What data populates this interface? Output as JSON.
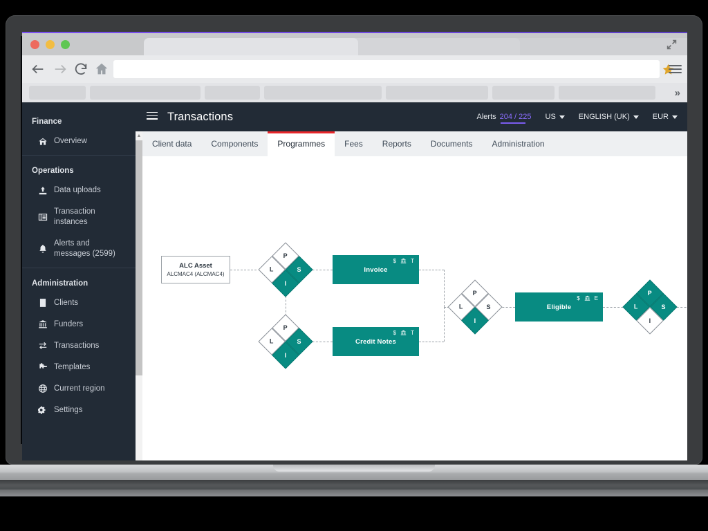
{
  "browser": {
    "window_controls": [
      "close",
      "minimize",
      "maximize"
    ],
    "nav": {
      "back_icon": "arrow-left-icon",
      "forward_icon": "arrow-right-icon",
      "reload_icon": "reload-icon",
      "home_icon": "home-icon",
      "bookmark_icon": "star-icon",
      "menu_icon": "hamburger-menu-icon",
      "overflow_label": "»"
    },
    "url_value": "",
    "url_placeholder": "",
    "tab_close_label": "✕"
  },
  "app": {
    "menu_toggle": "hamburger-menu-icon",
    "title": "Transactions",
    "header": {
      "alerts_label": "Alerts",
      "alerts_count": "204 / 225",
      "country": "US",
      "language": "ENGLISH (UK)",
      "currency": "EUR"
    },
    "sidebar": {
      "groups": [
        {
          "label": "Finance",
          "items": [
            {
              "label": "Overview",
              "icon": "home-icon"
            }
          ]
        },
        {
          "label": "Operations",
          "items": [
            {
              "label": "Data uploads",
              "icon": "upload-icon"
            },
            {
              "label": "Transaction instances",
              "icon": "list-icon"
            },
            {
              "label": "Alerts and messages (2599)",
              "icon": "bell-icon"
            }
          ]
        },
        {
          "label": "Administration",
          "items": [
            {
              "label": "Clients",
              "icon": "contact-card-icon"
            },
            {
              "label": "Funders",
              "icon": "bank-icon"
            },
            {
              "label": "Transactions",
              "icon": "exchange-icon"
            },
            {
              "label": "Templates",
              "icon": "puzzle-icon"
            },
            {
              "label": "Current region",
              "icon": "globe-icon"
            },
            {
              "label": "Settings",
              "icon": "gears-icon"
            }
          ]
        }
      ]
    },
    "tabs": [
      {
        "label": "Client data",
        "active": false
      },
      {
        "label": "Components",
        "active": false
      },
      {
        "label": "Programmes",
        "active": true
      },
      {
        "label": "Fees",
        "active": false
      },
      {
        "label": "Reports",
        "active": false
      },
      {
        "label": "Documents",
        "active": false
      },
      {
        "label": "Administration",
        "active": false
      }
    ],
    "colors": {
      "teal": "#088b82",
      "sidebar": "#222b36",
      "active_tab_accent": "#e8262a",
      "alerts_purple": "#8b6dff"
    },
    "diagram": {
      "asset": {
        "title": "ALC Asset",
        "subtitle": "ALCMAC4 (ALCMAC4)"
      },
      "boxes": [
        {
          "label": "Invoice",
          "icons": [
            "$",
            "bank-icon",
            "T"
          ]
        },
        {
          "label": "Credit Notes",
          "icons": [
            "$",
            "bank-icon",
            "T"
          ]
        },
        {
          "label": "Eligible",
          "icons": [
            "$",
            "bank-icon",
            "E"
          ]
        }
      ],
      "diamonds": [
        {
          "name": "diamond-invoice",
          "s": "S",
          "p": "P",
          "i": "I",
          "l": "L",
          "filled": [
            "s",
            "i"
          ]
        },
        {
          "name": "diamond-credit-notes",
          "s": "S",
          "p": "P",
          "i": "I",
          "l": "L",
          "filled": [
            "s",
            "i"
          ]
        },
        {
          "name": "diamond-eligible-in",
          "s": "S",
          "p": "P",
          "i": "I",
          "l": "L",
          "filled": [
            "i"
          ]
        },
        {
          "name": "diamond-eligible-out",
          "s": "S",
          "p": "P",
          "i": "I",
          "l": "L",
          "filled": [
            "s",
            "p",
            "l"
          ]
        }
      ]
    }
  }
}
